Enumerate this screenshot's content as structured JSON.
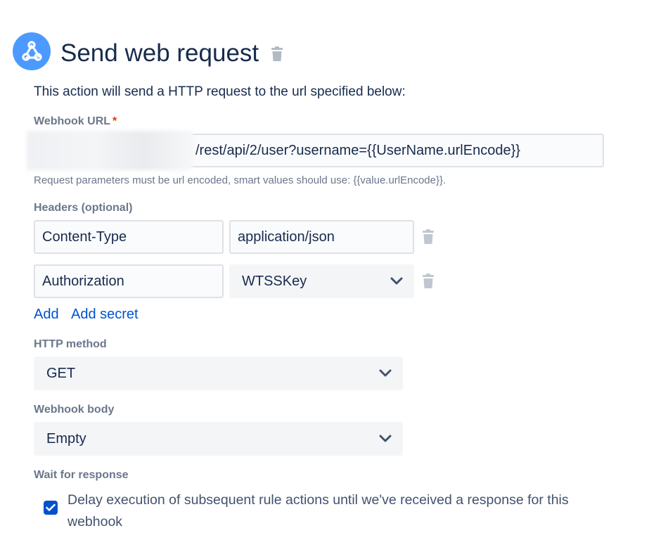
{
  "header": {
    "title": "Send web request",
    "icon": "webhook-icon",
    "delete_icon": "trash-icon"
  },
  "description": "This action will send a HTTP request to the url specified below:",
  "webhook_url": {
    "label": "Webhook URL",
    "required_marker": "*",
    "value": "/rest/api/2/user?username={{UserName.urlEncode}}",
    "hint": "Request parameters must be url encoded, smart values should use: {{value.urlEncode}}."
  },
  "headers": {
    "label": "Headers (optional)",
    "rows": [
      {
        "name": "Content-Type",
        "value": "application/json",
        "value_type": "text"
      },
      {
        "name": "Authorization",
        "value": "WTSSKey",
        "value_type": "select"
      }
    ],
    "add_label": "Add",
    "add_secret_label": "Add secret"
  },
  "http_method": {
    "label": "HTTP method",
    "selected": "GET"
  },
  "webhook_body": {
    "label": "Webhook body",
    "selected": "Empty"
  },
  "wait_for_response": {
    "label": "Wait for response",
    "checked": true,
    "checkbox_label": "Delay execution of subsequent rule actions until we've received a response for this webhook"
  },
  "colors": {
    "accent": "#0052CC",
    "icon_bg": "#4C9AFF",
    "required": "#DE350B",
    "label": "#6B778C"
  }
}
